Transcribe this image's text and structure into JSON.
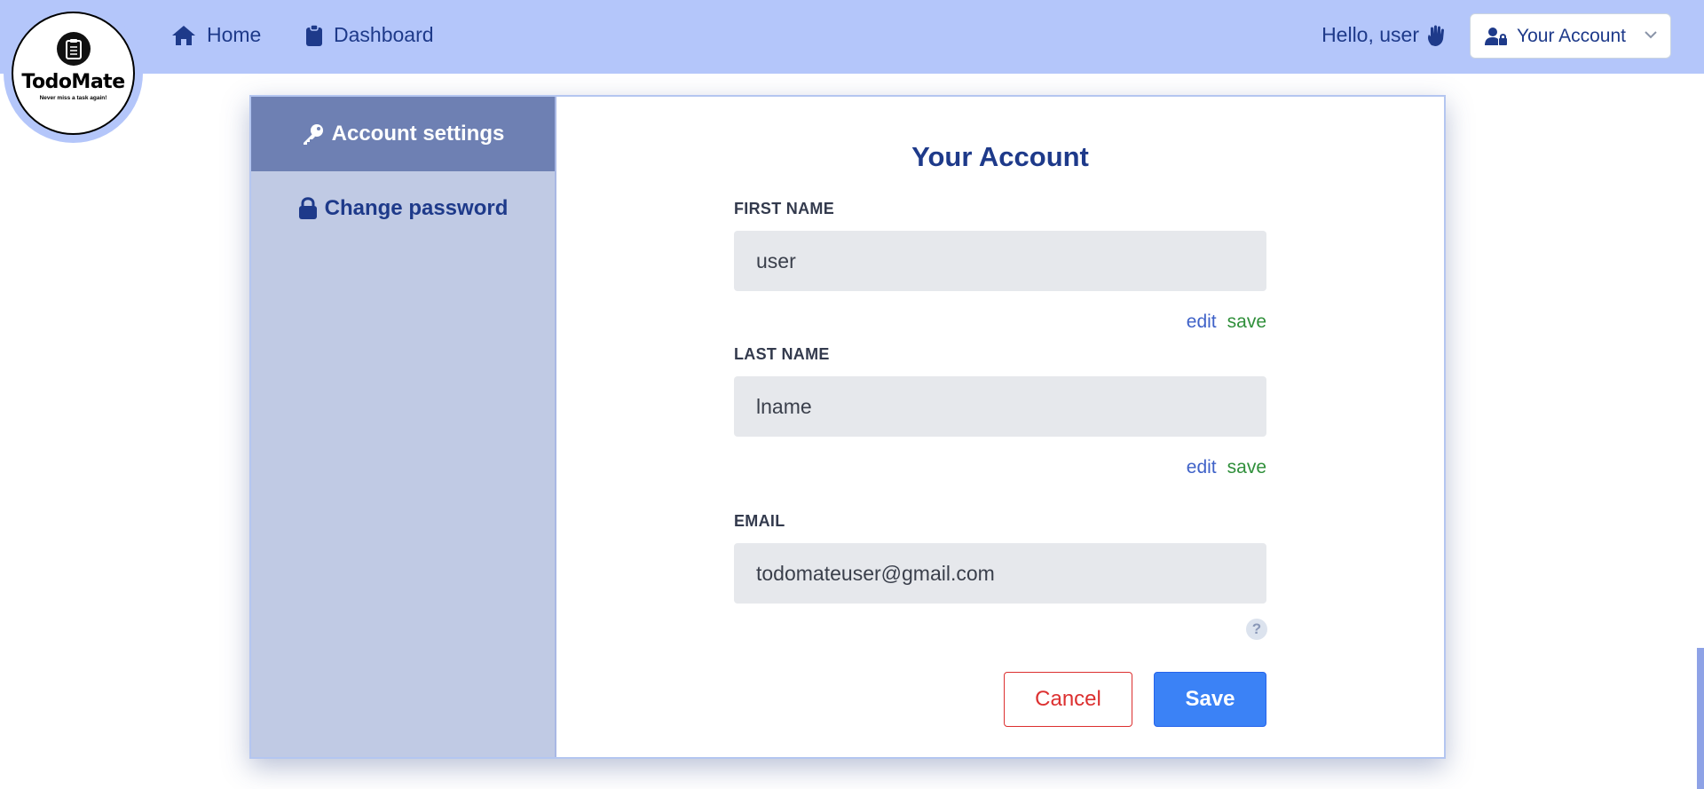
{
  "brand": {
    "name": "TodoMate",
    "tagline": "Never miss a task again!"
  },
  "nav": {
    "home_label": "Home",
    "dashboard_label": "Dashboard"
  },
  "header": {
    "greeting": "Hello, user",
    "account_label": "Your Account"
  },
  "sidebar": {
    "items": [
      {
        "label": "Account settings",
        "icon": "key-icon",
        "active": true
      },
      {
        "label": "Change password",
        "icon": "lock-icon",
        "active": false
      }
    ]
  },
  "form": {
    "title": "Your Account",
    "first_name": {
      "label": "FIRST NAME",
      "value": "user"
    },
    "last_name": {
      "label": "LAST NAME",
      "value": "lname"
    },
    "email": {
      "label": "EMAIL",
      "value": "todomateuser@gmail.com"
    },
    "edit_label": "edit",
    "save_link_label": "save",
    "help_symbol": "?",
    "cancel_label": "Cancel",
    "save_label": "Save"
  },
  "colors": {
    "navbar": "#b4c6fa",
    "primary_text": "#1e3a8a",
    "sidebar_bg": "#c0cae4",
    "sidebar_active": "#6e80b3",
    "save_button": "#3b82f6",
    "cancel_border": "#dc3030",
    "edit_link": "#3f62c8",
    "save_link": "#2f8f3a"
  }
}
